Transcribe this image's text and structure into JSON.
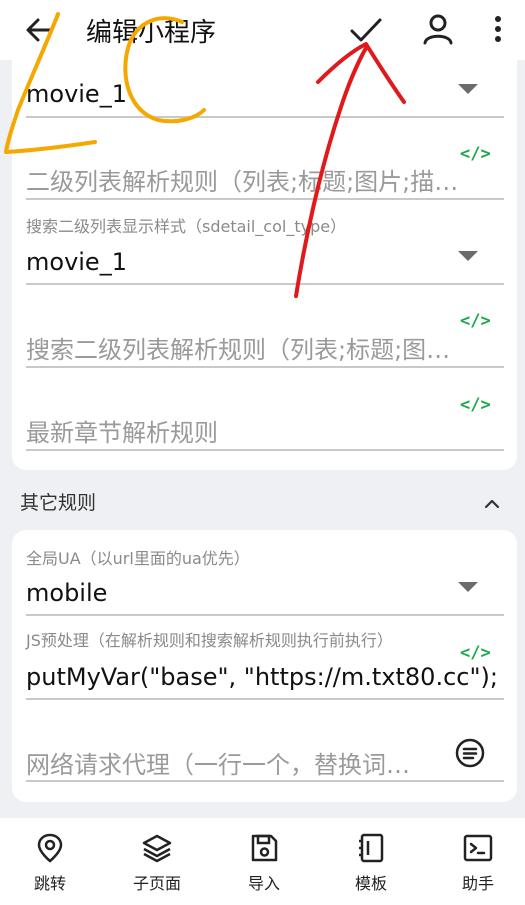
{
  "header": {
    "title": "编辑小程序",
    "back_icon": "arrow-left-icon",
    "confirm_icon": "check-icon",
    "account_icon": "person-icon",
    "more_icon": "more-vertical-icon"
  },
  "rules_card": {
    "type_field": {
      "value": "movie_1"
    },
    "second_list_rule": {
      "placeholder": "二级列表解析规则（列表;标题;图片;描…"
    },
    "search_second_style": {
      "label": "搜索二级列表显示样式（sdetail_col_type）",
      "value": "movie_1"
    },
    "search_second_rule": {
      "placeholder": "搜索二级列表解析规则（列表;标题;图…"
    },
    "latest_chapter_rule": {
      "placeholder": "最新章节解析规则"
    }
  },
  "other_rules": {
    "title": "其它规则",
    "global_ua": {
      "label": "全局UA（以url里面的ua优先）",
      "value": "mobile"
    },
    "js_preprocess": {
      "label": "JS预处理（在解析规则和搜索解析规则执行前执行）",
      "value": "putMyVar(\"base\", \"https://m.txt80.cc\");"
    },
    "proxy": {
      "placeholder": "网络请求代理（一行一个，替换词…"
    }
  },
  "code_icon_text": "</>",
  "bottom_nav": [
    {
      "label": "跳转",
      "icon": "location-pin-icon"
    },
    {
      "label": "子页面",
      "icon": "layers-icon"
    },
    {
      "label": "导入",
      "icon": "save-icon"
    },
    {
      "label": "模板",
      "icon": "notebook-icon"
    },
    {
      "label": "助手",
      "icon": "terminal-icon"
    }
  ],
  "colors": {
    "accent_code": "#1aa84a",
    "annotation_red": "#e01a1a",
    "annotation_orange": "#f5a800"
  }
}
